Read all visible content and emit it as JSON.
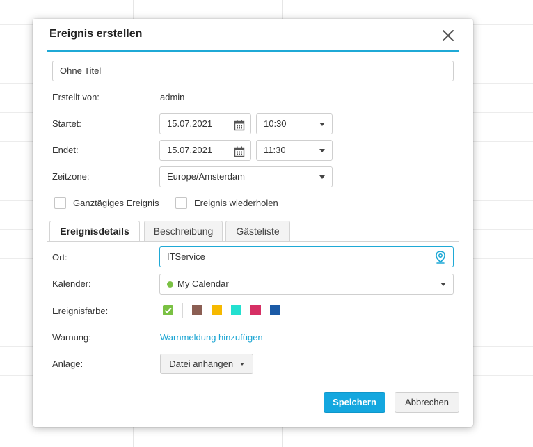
{
  "dialog": {
    "title": "Ereignis erstellen",
    "title_input_value": "Ohne Titel",
    "created_by_label": "Erstellt von:",
    "created_by_value": "admin",
    "start_label": "Startet:",
    "start_date": "15.07.2021",
    "start_time": "10:30",
    "end_label": "Endet:",
    "end_date": "15.07.2021",
    "end_time": "11:30",
    "timezone_label": "Zeitzone:",
    "timezone_value": "Europe/Amsterdam",
    "all_day_label": "Ganztägiges Ereignis",
    "all_day_checked": false,
    "repeat_label": "Ereignis wiederholen",
    "repeat_checked": false
  },
  "tabs": [
    {
      "label": "Ereignisdetails",
      "active": true
    },
    {
      "label": "Beschreibung",
      "active": false
    },
    {
      "label": "Gästeliste",
      "active": false
    }
  ],
  "details": {
    "location_label": "Ort:",
    "location_value": "ITService",
    "calendar_label": "Kalender:",
    "calendar_value": "My Calendar",
    "calendar_dot_color": "#7ac143",
    "color_label": "Ereignisfarbe:",
    "colors": [
      "#8b5e53",
      "#f6b900",
      "#23e0d0",
      "#d62f64",
      "#1b5aa6"
    ],
    "selected_color": "#7ac143",
    "warning_label": "Warnung:",
    "warning_link": "Warnmeldung hinzufügen",
    "attachment_label": "Anlage:",
    "attachment_button": "Datei anhängen"
  },
  "footer": {
    "save_label": "Speichern",
    "cancel_label": "Abbrechen"
  },
  "colors": {
    "accent": "#1fa9d6",
    "primary_button": "#14a7df",
    "link": "#1ba5d3"
  }
}
